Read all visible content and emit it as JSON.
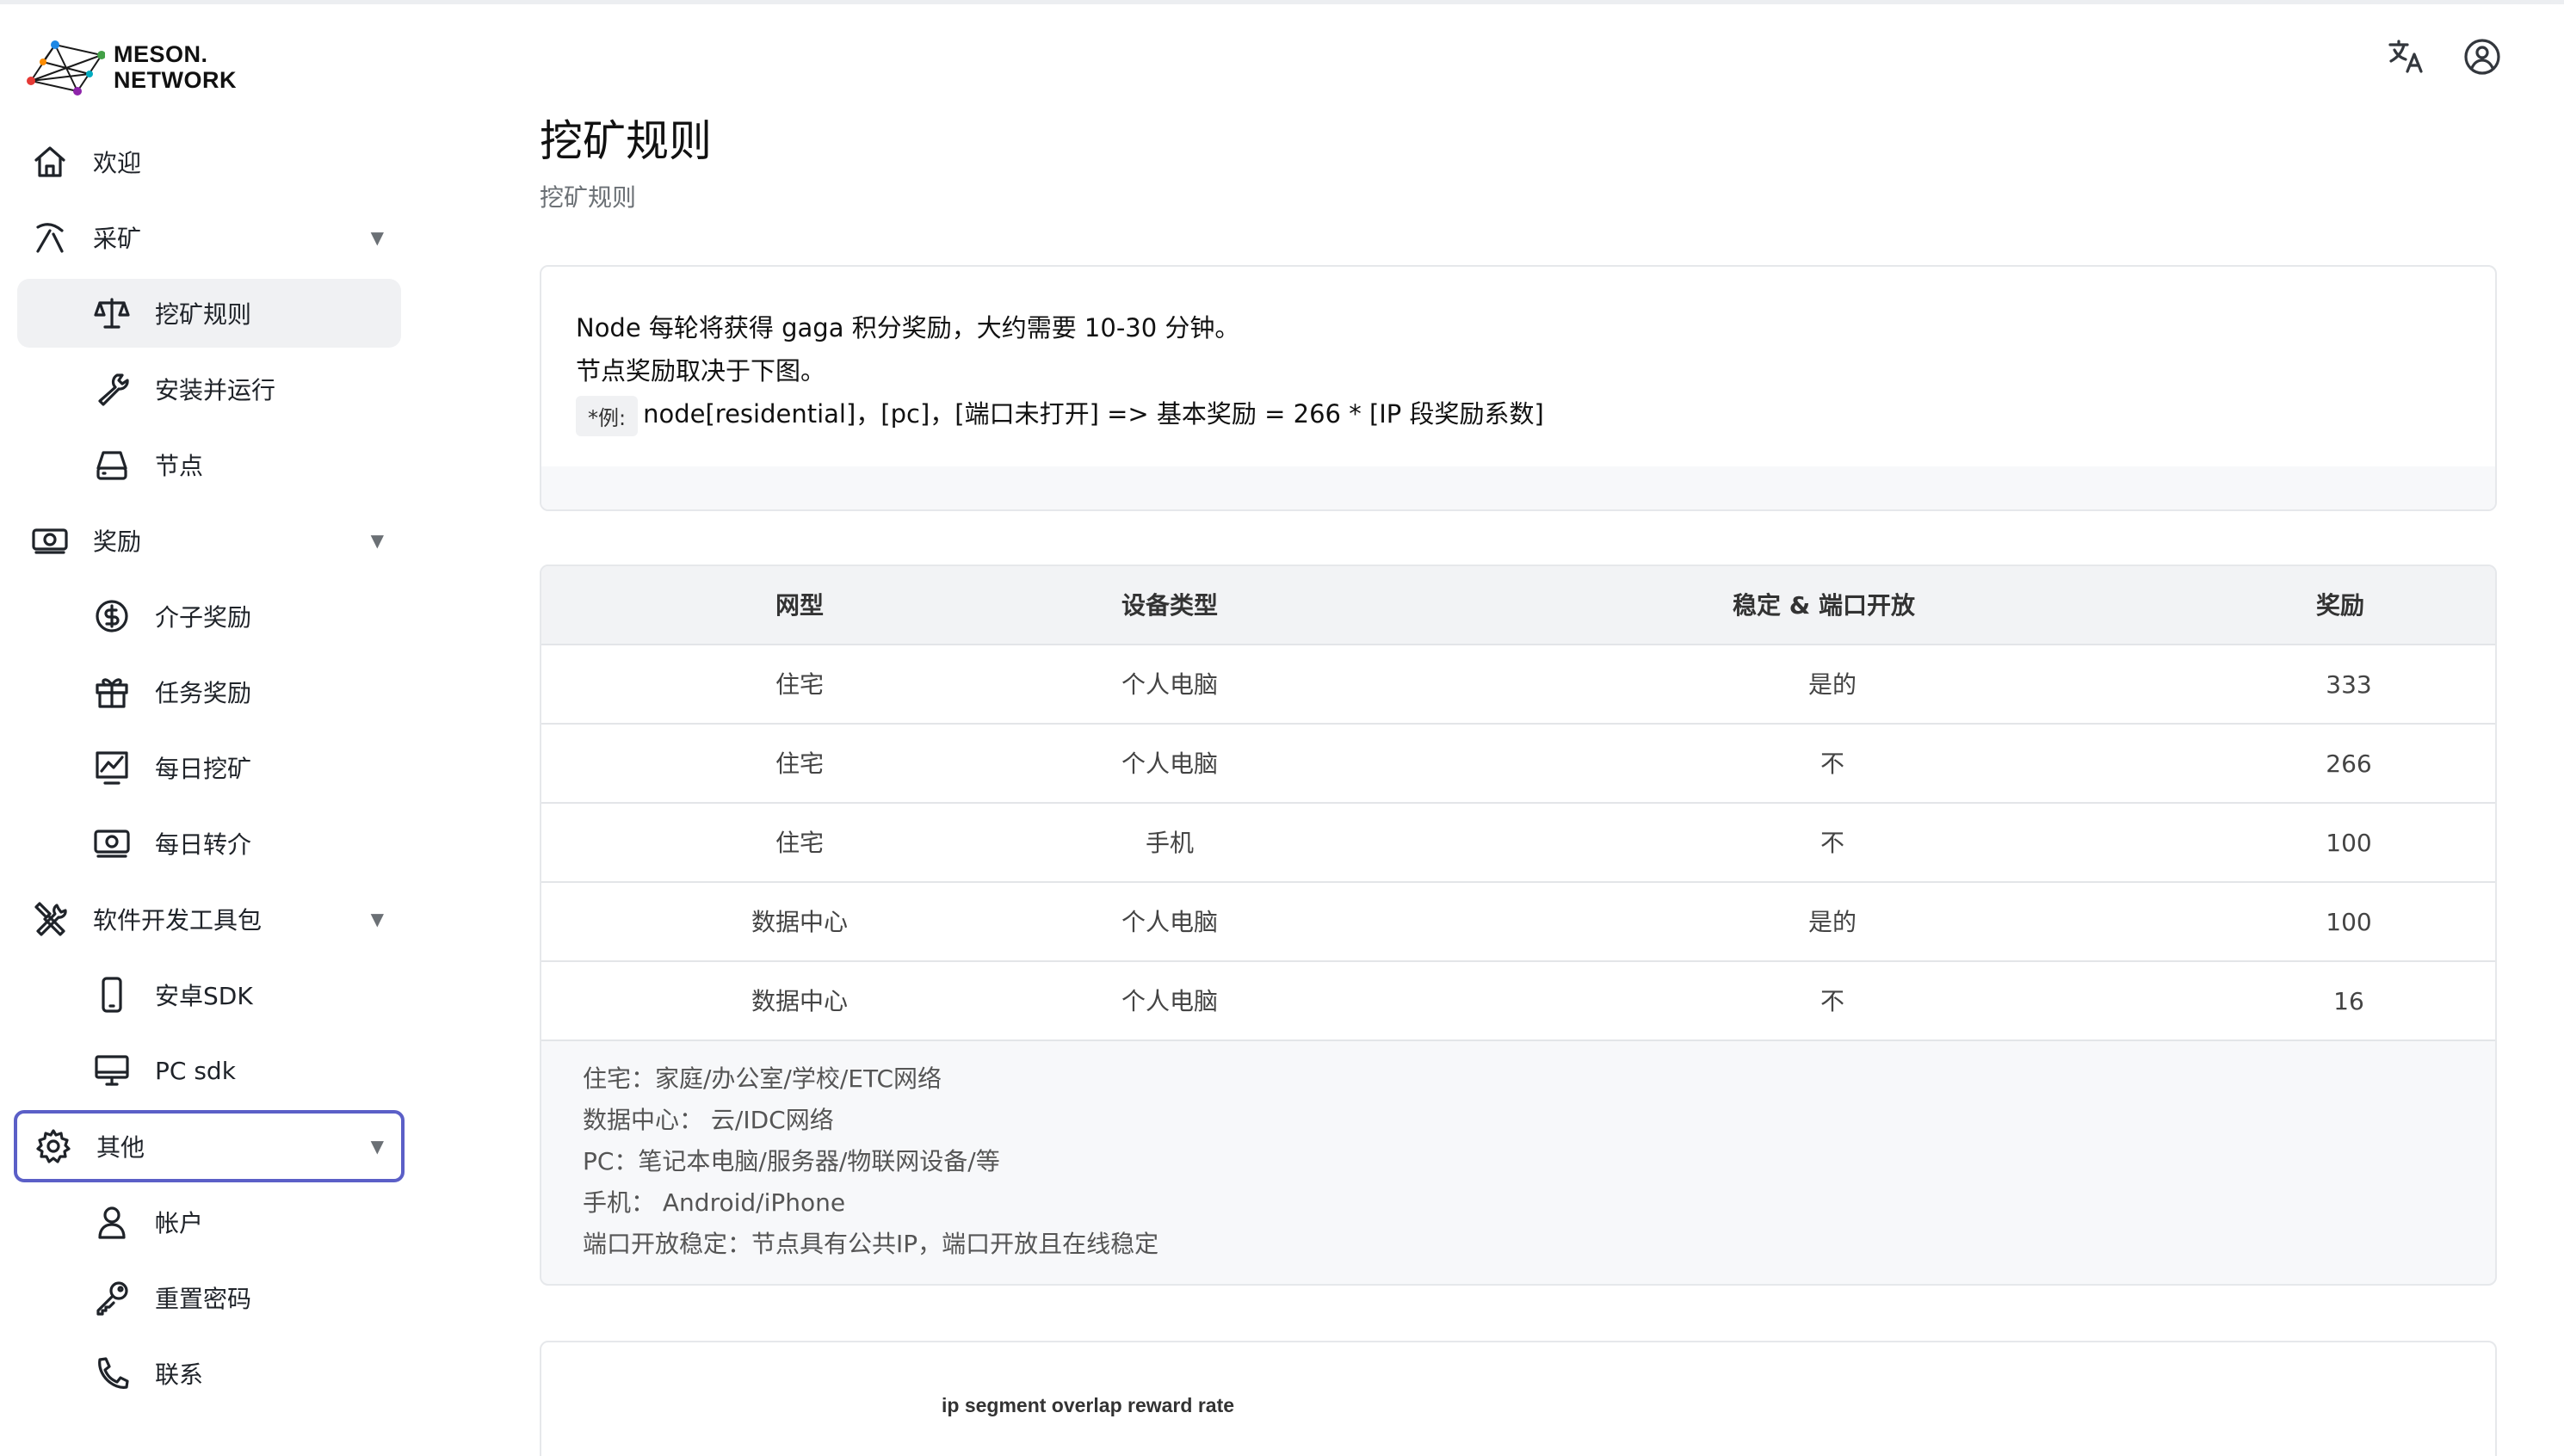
{
  "brand": {
    "line1": "MESON.",
    "line2": "NETWORK"
  },
  "sidebar": {
    "welcome": "欢迎",
    "mining": {
      "label": "采矿",
      "children": {
        "rules": "挖矿规则",
        "install": "安装并运行",
        "nodes": "节点"
      }
    },
    "rewards": {
      "label": "奖励",
      "children": {
        "referral": "介子奖励",
        "task": "任务奖励",
        "daily_mining": "每日挖矿",
        "daily_referral": "每日转介"
      }
    },
    "sdk": {
      "label": "软件开发工具包",
      "children": {
        "android": "安卓SDK",
        "pc": "PC sdk"
      }
    },
    "other": {
      "label": "其他",
      "children": {
        "account": "帐户",
        "reset_password": "重置密码",
        "contact": "联系"
      }
    }
  },
  "header": {
    "translate_icon": "translate-icon",
    "user_icon": "user-icon"
  },
  "main": {
    "title": "挖矿规则",
    "subtitle": "挖矿规则",
    "info": {
      "line1": "Node 每轮将获得 gaga 积分奖励，大约需要 10-30 分钟。",
      "line2": "节点奖励取决于下图。",
      "example_tag": "*例:",
      "example_text": "node[residential]，[pc]，[端口未打开] => 基本奖励 = 266 * [IP 段奖励系数]"
    },
    "table": {
      "headers": [
        "网型",
        "设备类型",
        "稳定 & 端口开放",
        "奖励"
      ],
      "rows": [
        [
          "住宅",
          "个人电脑",
          "是的",
          "333"
        ],
        [
          "住宅",
          "个人电脑",
          "不",
          "266"
        ],
        [
          "住宅",
          "手机",
          "不",
          "100"
        ],
        [
          "数据中心",
          "个人电脑",
          "是的",
          "100"
        ],
        [
          "数据中心",
          "个人电脑",
          "不",
          "16"
        ]
      ],
      "notes": [
        "住宅：家庭/办公室/学校/ETC网络",
        "数据中心： 云/IDC网络",
        "PC：笔记本电脑/服务器/物联网设备/等",
        "手机： Android/iPhone",
        "端口开放稳定：节点具有公共IP，端口开放且在线稳定"
      ]
    },
    "chart_title": "ip segment overlap reward rate"
  }
}
